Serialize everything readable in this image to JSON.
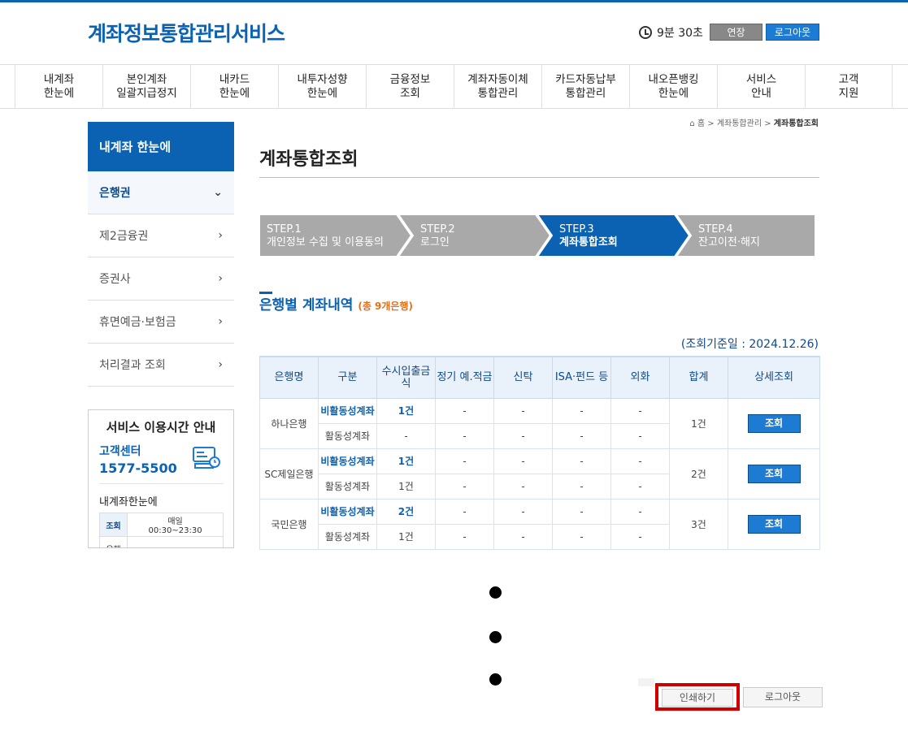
{
  "header": {
    "logo": "계좌정보통합관리서비스",
    "timer": "9분 30초",
    "extend_label": "연장",
    "logout_label": "로그아웃"
  },
  "gnb": [
    {
      "label": "내계좌\n한눈에"
    },
    {
      "label": "본인계좌\n일괄지급정지"
    },
    {
      "label": "내카드\n한눈에"
    },
    {
      "label": "내투자성향\n한눈에"
    },
    {
      "label": "금융정보\n조회"
    },
    {
      "label": "계좌자동이체\n통합관리"
    },
    {
      "label": "카드자동납부\n통합관리"
    },
    {
      "label": "내오픈뱅킹\n한눈에"
    },
    {
      "label": "서비스\n안내"
    },
    {
      "label": "고객\n지원"
    }
  ],
  "lnb": {
    "title": "내계좌 한눈에",
    "items": [
      {
        "label": "은행권",
        "icon": "chevron-down-icon",
        "glyph": "⌄"
      },
      {
        "label": "제2금융권",
        "icon": "chevron-right-icon",
        "glyph": "›"
      },
      {
        "label": "증권사",
        "icon": "chevron-right-icon",
        "glyph": "›"
      },
      {
        "label": "휴면예금·보험금",
        "icon": "chevron-right-icon",
        "glyph": "›"
      },
      {
        "label": "처리결과 조회",
        "icon": "chevron-right-icon",
        "glyph": "›"
      }
    ]
  },
  "service_box": {
    "title": "서비스 이용시간 안내",
    "center_label": "고객센터",
    "center_phone": "1577-5500",
    "sub_title": "내계좌한눈에",
    "row1_label": "조회",
    "row1_value_1": "매일",
    "row1_value_2": "00:30~23:30",
    "row2_label": "은행"
  },
  "breadcrumb": {
    "home": "홈",
    "sep": ">",
    "level1": "계좌통합관리",
    "current": "계좌통합조회"
  },
  "page_title": "계좌통합조회",
  "steps": [
    {
      "step": "STEP.1",
      "label": "개인정보 수집 및 이용동의",
      "active": false
    },
    {
      "step": "STEP.2",
      "label": "로그인",
      "active": false
    },
    {
      "step": "STEP.3",
      "label": "계좌통합조회",
      "active": true
    },
    {
      "step": "STEP.4",
      "label": "잔고이전·해지",
      "active": false
    }
  ],
  "section": {
    "title": "은행별 계좌내역",
    "count": "(총 9개은행)",
    "base_date": "(조회기준일 : 2024.12.26)"
  },
  "table": {
    "headers": [
      "은행명",
      "구분",
      "수시입출금식",
      "정기 예.적금",
      "신탁",
      "ISA·펀드 등",
      "외화",
      "합계",
      "상세조회"
    ],
    "rows": [
      {
        "bank": "하나은행",
        "total": "1건",
        "button": "조회",
        "sub": [
          {
            "type": "비활동성계좌",
            "values": [
              "1건",
              "-",
              "-",
              "-",
              "-"
            ]
          },
          {
            "type": "활동성계좌",
            "values": [
              "-",
              "-",
              "-",
              "-",
              "-"
            ]
          }
        ]
      },
      {
        "bank": "SC제일은행",
        "total": "2건",
        "button": "조회",
        "sub": [
          {
            "type": "비활동성계좌",
            "values": [
              "1건",
              "-",
              "-",
              "-",
              "-"
            ]
          },
          {
            "type": "활동성계좌",
            "values": [
              "1건",
              "-",
              "-",
              "-",
              "-"
            ]
          }
        ]
      },
      {
        "bank": "국민은행",
        "total": "3건",
        "button": "조회",
        "sub": [
          {
            "type": "비활동성계좌",
            "values": [
              "2건",
              "-",
              "-",
              "-",
              "-"
            ]
          },
          {
            "type": "활동성계좌",
            "values": [
              "1건",
              "-",
              "-",
              "-",
              "-"
            ]
          }
        ]
      }
    ]
  },
  "bottom": {
    "print_label": "인쇄하기",
    "logout_label": "로그아웃"
  },
  "colors": {
    "brand": "#0b62b3",
    "step_active": "#0b62b3",
    "step_inactive": "#a9a9a9",
    "highlight": "#d10000",
    "accent_orange": "#e5701b"
  }
}
